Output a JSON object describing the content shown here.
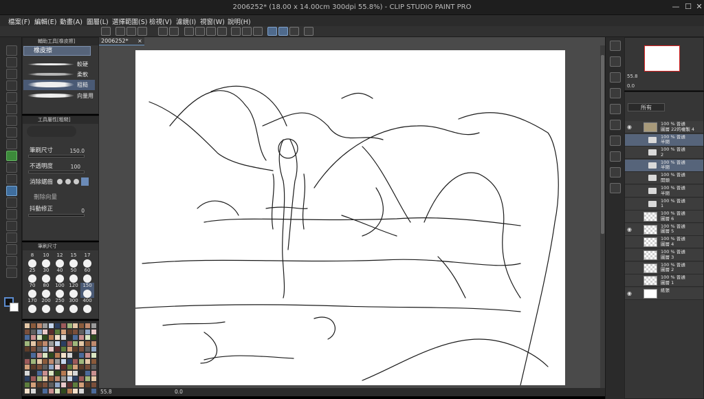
{
  "window": {
    "title": "2006252* (18.00 x 14.00cm 300dpi 55.8%) - CLIP STUDIO PAINT PRO",
    "minimize": "—",
    "maximize": "☐",
    "close": "✕"
  },
  "menu": [
    "檔案(F)",
    "編輯(E)",
    "動畫(A)",
    "圖層(L)",
    "選擇範圍(S)",
    "檢視(V)",
    "濾鏡(I)",
    "視窗(W)",
    "說明(H)"
  ],
  "document_tab": {
    "label": "2006252*",
    "close": "×"
  },
  "subtool": {
    "header": "輔助工具[橡皮擦]",
    "active": "橡皮擦",
    "brushes": [
      {
        "label": "較硬"
      },
      {
        "label": "柔軟"
      },
      {
        "label": "粗糙"
      },
      {
        "label": "向量用"
      }
    ]
  },
  "toolprop": {
    "header": "工具屬性[粗糙]",
    "brush_size_label": "筆刷尺寸",
    "brush_size_value": "150.0",
    "opacity_label": "不透明度",
    "opacity_value": "100",
    "antialias_label": "消除鋸齒",
    "delete_vector_label": "刪除向量",
    "stabilization_label": "抖動修正",
    "stabilization_value": "0"
  },
  "brushsize": {
    "header": "筆刷尺寸",
    "sizes": [
      "8",
      "10",
      "12",
      "15",
      "17",
      "25",
      "30",
      "40",
      "50",
      "60",
      "70",
      "80",
      "100",
      "120",
      "150",
      "170",
      "200",
      "250",
      "300",
      "400"
    ],
    "selected": "150"
  },
  "status": {
    "zoom": "55.8",
    "angle": "0.0"
  },
  "navigator": {
    "zoom": "55.8",
    "angle": "0.0"
  },
  "layers": {
    "blend_mode": "所有",
    "mode_label": "普通",
    "rows": [
      {
        "line1": "100 % 普通",
        "line2": "圖層 22的複製 4",
        "kind": "image",
        "eye": true
      },
      {
        "line1": "100 % 普通",
        "line2": "半閉",
        "kind": "folder",
        "sel": true
      },
      {
        "line1": "100 % 普通",
        "line2": "2",
        "kind": "folder"
      },
      {
        "line1": "100 % 普通",
        "line2": "半閉",
        "kind": "folder",
        "sel": true
      },
      {
        "line1": "100 % 普通",
        "line2": "開頭",
        "kind": "folder"
      },
      {
        "line1": "100 % 普通",
        "line2": "半閉",
        "kind": "folder"
      },
      {
        "line1": "100 % 普通",
        "line2": "1",
        "kind": "folder"
      },
      {
        "line1": "100 % 普通",
        "line2": "圖層 6",
        "kind": "layer"
      },
      {
        "line1": "100 % 普通",
        "line2": "圖層 5",
        "kind": "layer",
        "eye": true
      },
      {
        "line1": "100 % 普通",
        "line2": "圖層 4",
        "kind": "layer"
      },
      {
        "line1": "100 % 普通",
        "line2": "圖層 3",
        "kind": "layer"
      },
      {
        "line1": "100 % 普通",
        "line2": "圖層 2",
        "kind": "layer"
      },
      {
        "line1": "100 % 普通",
        "line2": "圖層 1",
        "kind": "layer"
      },
      {
        "line1": "",
        "line2": "紙張",
        "kind": "paper",
        "eye": true
      }
    ]
  },
  "colors": {
    "accent": "#56647a",
    "tool_active": "#3f6e9e",
    "panel": "#363636"
  }
}
